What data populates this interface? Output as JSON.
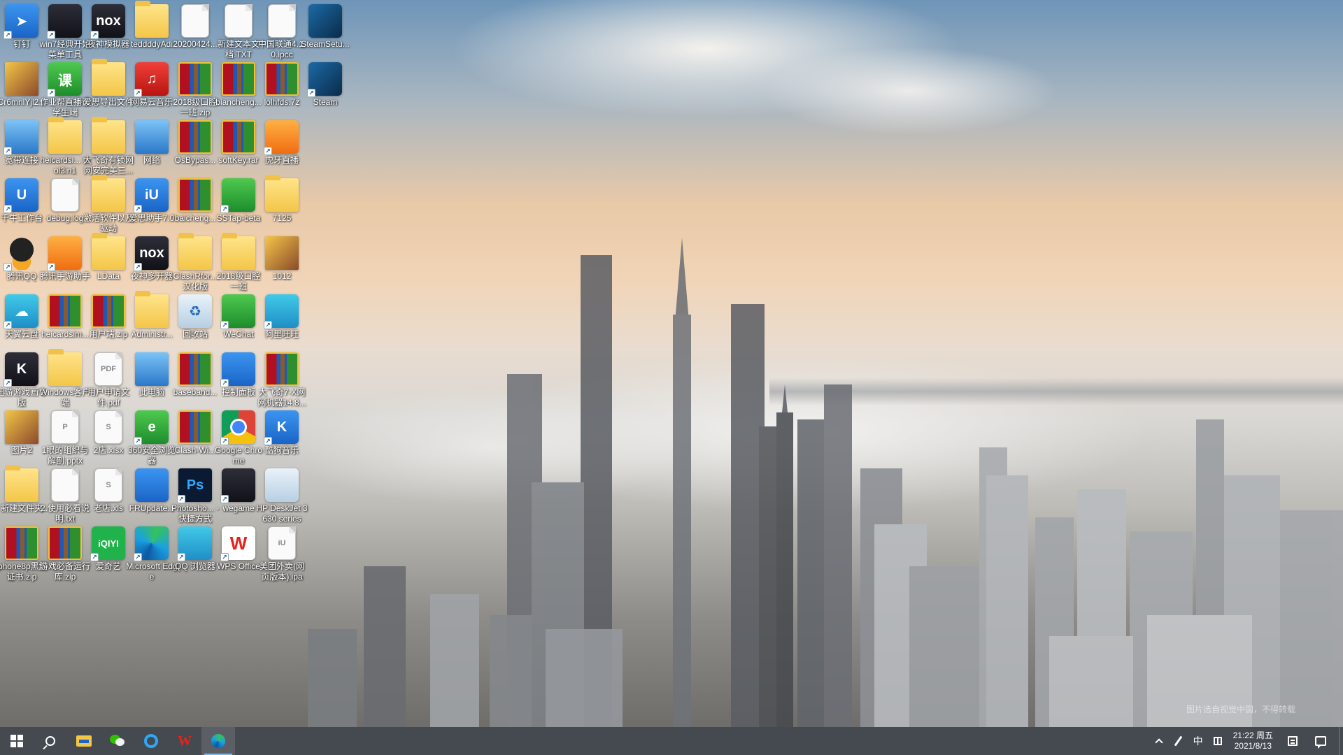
{
  "desktop": {
    "icons": [
      {
        "col": 0,
        "row": 0,
        "label": "钉钉",
        "type": "g-blue",
        "glyph": "➤",
        "shortcut": true
      },
      {
        "col": 0,
        "row": 1,
        "label": "Cr6mnlYjl2...",
        "type": "g-photo",
        "glyph": "",
        "shortcut": false
      },
      {
        "col": 0,
        "row": 2,
        "label": "宽带连接",
        "type": "g-pc",
        "glyph": "",
        "shortcut": true
      },
      {
        "col": 0,
        "row": 3,
        "label": "千牛工作台",
        "type": "g-blue",
        "glyph": "U",
        "shortcut": true
      },
      {
        "col": 0,
        "row": 4,
        "label": "腾讯QQ",
        "type": "g-qq",
        "glyph": "",
        "shortcut": true
      },
      {
        "col": 0,
        "row": 5,
        "label": "天翼云盘",
        "type": "g-teal",
        "glyph": "☁",
        "shortcut": true
      },
      {
        "col": 0,
        "row": 6,
        "label": "迅游游戏画专版",
        "type": "g-dark",
        "glyph": "K",
        "shortcut": true
      },
      {
        "col": 0,
        "row": 7,
        "label": "图片2",
        "type": "g-photo",
        "glyph": "",
        "shortcut": false
      },
      {
        "col": 0,
        "row": 8,
        "label": "新建文件夹",
        "type": "g-folder",
        "glyph": "",
        "shortcut": false
      },
      {
        "col": 0,
        "row": 9,
        "label": "iphone8p黑解证书.zip",
        "type": "g-rar",
        "glyph": "",
        "shortcut": false
      },
      {
        "col": 1,
        "row": 0,
        "label": "win7经典开始菜单工具",
        "type": "g-dark",
        "glyph": "",
        "shortcut": true
      },
      {
        "col": 1,
        "row": 1,
        "label": "作业帮直播课学生端",
        "type": "g-green",
        "glyph": "课",
        "shortcut": true
      },
      {
        "col": 1,
        "row": 2,
        "label": "heicardsi... tool3in1",
        "type": "g-folder",
        "glyph": "",
        "shortcut": false
      },
      {
        "col": 1,
        "row": 3,
        "label": "debug.log",
        "type": "g-doc",
        "glyph": "",
        "shortcut": false
      },
      {
        "col": 1,
        "row": 4,
        "label": "腾讯手游助手",
        "type": "g-orange",
        "glyph": "",
        "shortcut": true
      },
      {
        "col": 1,
        "row": 5,
        "label": "heicardsim...",
        "type": "g-rar",
        "glyph": "",
        "shortcut": false
      },
      {
        "col": 1,
        "row": 6,
        "label": "Windows客户端",
        "type": "g-folder",
        "glyph": "",
        "shortcut": false
      },
      {
        "col": 1,
        "row": 7,
        "label": "1眼的组织与解剖.pptx",
        "type": "g-doc",
        "glyph": "P",
        "shortcut": false
      },
      {
        "col": 1,
        "row": 8,
        "label": "2.使用必看说明.txt",
        "type": "g-doc",
        "glyph": "",
        "shortcut": false
      },
      {
        "col": 1,
        "row": 9,
        "label": "游戏必备运行库.zip",
        "type": "g-rar",
        "glyph": "",
        "shortcut": false
      },
      {
        "col": 2,
        "row": 0,
        "label": "夜神模拟器",
        "type": "g-dark",
        "glyph": "nox",
        "shortcut": true
      },
      {
        "col": 2,
        "row": 1,
        "label": "爱思导出文件",
        "type": "g-folder",
        "glyph": "",
        "shortcut": false
      },
      {
        "col": 2,
        "row": 2,
        "label": "大飞奇有锁网网安完美三...",
        "type": "g-folder",
        "glyph": "",
        "shortcut": false
      },
      {
        "col": 2,
        "row": 3,
        "label": "激活软件以及驱动",
        "type": "g-folder",
        "glyph": "",
        "shortcut": false
      },
      {
        "col": 2,
        "row": 4,
        "label": "LData",
        "type": "g-folder",
        "glyph": "",
        "shortcut": false
      },
      {
        "col": 2,
        "row": 5,
        "label": "用户端.zip",
        "type": "g-rar",
        "glyph": "",
        "shortcut": false
      },
      {
        "col": 2,
        "row": 6,
        "label": "用户申请文件.pdf",
        "type": "g-doc",
        "glyph": "PDF",
        "shortcut": false
      },
      {
        "col": 2,
        "row": 7,
        "label": "2店.xlsx",
        "type": "g-doc",
        "glyph": "S",
        "shortcut": false
      },
      {
        "col": 2,
        "row": 8,
        "label": "老店.xls",
        "type": "g-doc",
        "glyph": "S",
        "shortcut": false
      },
      {
        "col": 2,
        "row": 9,
        "label": "爱奇艺",
        "type": "g-iqiyi",
        "glyph": "iQIYI",
        "shortcut": true
      },
      {
        "col": 3,
        "row": 0,
        "label": "teddddyAdi",
        "type": "g-folder",
        "glyph": "",
        "shortcut": false
      },
      {
        "col": 3,
        "row": 1,
        "label": "网易云音乐",
        "type": "g-red",
        "glyph": "♫",
        "shortcut": true
      },
      {
        "col": 3,
        "row": 2,
        "label": "网络",
        "type": "g-pc",
        "glyph": "",
        "shortcut": false
      },
      {
        "col": 3,
        "row": 3,
        "label": "爱思助手7.0",
        "type": "g-blue",
        "glyph": "iU",
        "shortcut": true
      },
      {
        "col": 3,
        "row": 4,
        "label": "夜神多开器",
        "type": "g-dark",
        "glyph": "nox",
        "shortcut": true
      },
      {
        "col": 3,
        "row": 5,
        "label": "Administr...",
        "type": "g-folder",
        "glyph": "",
        "shortcut": false
      },
      {
        "col": 3,
        "row": 6,
        "label": "此电脑",
        "type": "g-pc",
        "glyph": "",
        "shortcut": false
      },
      {
        "col": 3,
        "row": 7,
        "label": "360安全浏览器",
        "type": "g-green",
        "glyph": "e",
        "shortcut": true
      },
      {
        "col": 3,
        "row": 8,
        "label": "FRUpdate...",
        "type": "g-blue",
        "glyph": "",
        "shortcut": false
      },
      {
        "col": 3,
        "row": 9,
        "label": "Microsoft Edge",
        "type": "g-edge",
        "glyph": "",
        "shortcut": true
      },
      {
        "col": 4,
        "row": 0,
        "label": "20200424...",
        "type": "g-doc",
        "glyph": "",
        "shortcut": false
      },
      {
        "col": 4,
        "row": 1,
        "label": "2018级口腔一班.zip",
        "type": "g-rar",
        "glyph": "",
        "shortcut": false
      },
      {
        "col": 4,
        "row": 2,
        "label": "OsBypas...",
        "type": "g-rar",
        "glyph": "",
        "shortcut": false
      },
      {
        "col": 4,
        "row": 3,
        "label": "baicheng...",
        "type": "g-rar",
        "glyph": "",
        "shortcut": false
      },
      {
        "col": 4,
        "row": 4,
        "label": "ClashRfor... 汉化版",
        "type": "g-folder",
        "glyph": "",
        "shortcut": false
      },
      {
        "col": 4,
        "row": 5,
        "label": "回收站",
        "type": "g-recycle",
        "glyph": "♻",
        "shortcut": false
      },
      {
        "col": 4,
        "row": 6,
        "label": "baseband...",
        "type": "g-rar",
        "glyph": "",
        "shortcut": false
      },
      {
        "col": 4,
        "row": 7,
        "label": "Clash-Wi...",
        "type": "g-rar",
        "glyph": "",
        "shortcut": false
      },
      {
        "col": 4,
        "row": 8,
        "label": "Photosho... - 快捷方式",
        "type": "g-ps",
        "glyph": "Ps",
        "shortcut": true
      },
      {
        "col": 4,
        "row": 9,
        "label": "QQ 浏览器",
        "type": "g-teal",
        "glyph": "",
        "shortcut": true
      },
      {
        "col": 5,
        "row": 0,
        "label": "新建文本文档.TXT",
        "type": "g-doc",
        "glyph": "",
        "shortcut": false
      },
      {
        "col": 5,
        "row": 1,
        "label": "biancheng...",
        "type": "g-rar",
        "glyph": "",
        "shortcut": false
      },
      {
        "col": 5,
        "row": 2,
        "label": "softKey.rar",
        "type": "g-rar",
        "glyph": "",
        "shortcut": false
      },
      {
        "col": 5,
        "row": 3,
        "label": "SSTap-beta",
        "type": "g-green",
        "glyph": "",
        "shortcut": true
      },
      {
        "col": 5,
        "row": 4,
        "label": "2018级口腔一班",
        "type": "g-folder",
        "glyph": "",
        "shortcut": false
      },
      {
        "col": 5,
        "row": 5,
        "label": "WeChat",
        "type": "g-green",
        "glyph": "",
        "shortcut": true
      },
      {
        "col": 5,
        "row": 6,
        "label": "控制面板",
        "type": "g-blue",
        "glyph": "",
        "shortcut": true
      },
      {
        "col": 5,
        "row": 7,
        "label": "Google Chrome",
        "type": "g-chrome",
        "glyph": "",
        "shortcut": true
      },
      {
        "col": 5,
        "row": 8,
        "label": "wegame",
        "type": "g-dark",
        "glyph": "",
        "shortcut": true
      },
      {
        "col": 5,
        "row": 9,
        "label": "WPS Office",
        "type": "g-wps",
        "glyph": "W",
        "shortcut": true
      },
      {
        "col": 6,
        "row": 0,
        "label": "中国联通4.1.0.ipcc",
        "type": "g-doc",
        "glyph": "",
        "shortcut": false
      },
      {
        "col": 6,
        "row": 1,
        "label": "lolhfds.7z",
        "type": "g-rar",
        "glyph": "",
        "shortcut": false
      },
      {
        "col": 6,
        "row": 2,
        "label": "虎牙直播",
        "type": "g-orange",
        "glyph": "",
        "shortcut": true
      },
      {
        "col": 6,
        "row": 3,
        "label": "7125",
        "type": "g-folder",
        "glyph": "",
        "shortcut": false
      },
      {
        "col": 6,
        "row": 4,
        "label": "1012",
        "type": "g-photo",
        "glyph": "",
        "shortcut": false
      },
      {
        "col": 6,
        "row": 5,
        "label": "阿里旺旺",
        "type": "g-teal",
        "glyph": "",
        "shortcut": true
      },
      {
        "col": 6,
        "row": 6,
        "label": "大飞奇7-X网网机器14.8...",
        "type": "g-rar",
        "glyph": "",
        "shortcut": false
      },
      {
        "col": 6,
        "row": 7,
        "label": "酷狗音乐",
        "type": "g-blue",
        "glyph": "K",
        "shortcut": true
      },
      {
        "col": 6,
        "row": 8,
        "label": "HP DeskJet 3630 series",
        "type": "g-recycle",
        "glyph": "",
        "shortcut": false
      },
      {
        "col": 6,
        "row": 9,
        "label": "美团外卖(网页版本).ipa",
        "type": "g-doc",
        "glyph": "iU",
        "shortcut": false
      },
      {
        "col": 7,
        "row": 0,
        "label": "SteamSetu...",
        "type": "g-steam",
        "glyph": "",
        "shortcut": false
      },
      {
        "col": 7,
        "row": 1,
        "label": "Steam",
        "type": "g-steam",
        "glyph": "",
        "shortcut": true
      }
    ]
  },
  "wallpaper": {
    "watermark": "图片选自视觉中国，不得转载"
  },
  "taskbar": {
    "pinned": [
      {
        "name": "start-button",
        "glyph": "win-logo"
      },
      {
        "name": "search-button",
        "glyph": "search-glyph"
      },
      {
        "name": "file-explorer-button",
        "glyph": "explorer-glyph"
      },
      {
        "name": "wechat-taskbar-button",
        "glyph": "wechat-glyph"
      },
      {
        "name": "qq-browser-taskbar-button",
        "glyph": "qqb-glyph"
      },
      {
        "name": "wps-taskbar-button",
        "glyph": "wps-glyph"
      },
      {
        "name": "edge-taskbar-button",
        "glyph": "edge-glyph",
        "active": true
      }
    ],
    "wps_glyph_text": "W",
    "tray": {
      "ime_label": "中",
      "time": "21:22 周五",
      "date": "2021/8/13"
    }
  }
}
